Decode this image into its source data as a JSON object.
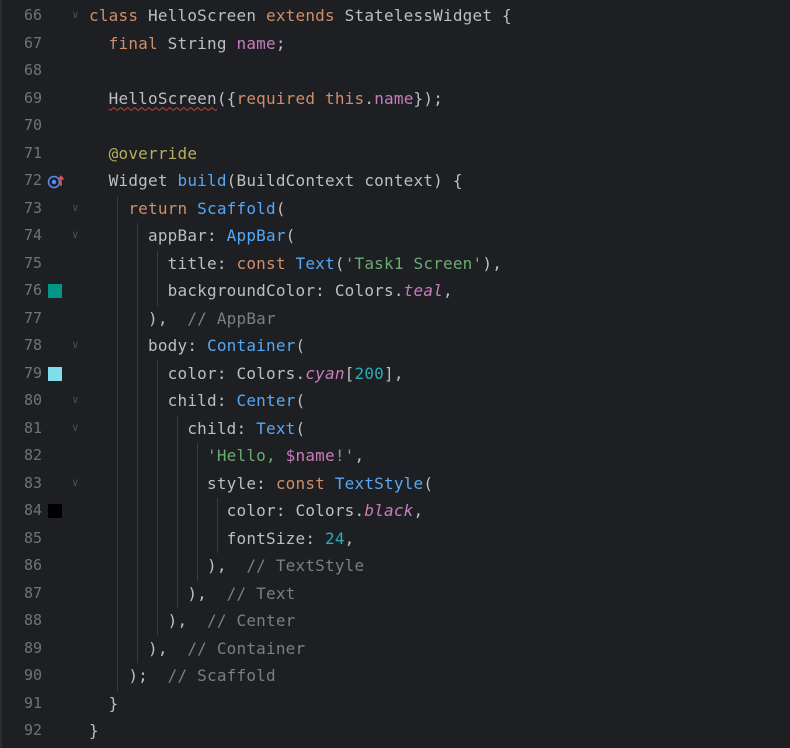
{
  "editor": {
    "colors": {
      "background": "#1e1f22",
      "teal_swatch": "#009688",
      "cyan200_swatch": "#80deea",
      "black_swatch": "#000000"
    },
    "gutter_icon": "override-method-icon",
    "lines": [
      {
        "n": "66",
        "tokens": [
          {
            "t": "class ",
            "c": "kw"
          },
          {
            "t": "HelloScreen ",
            "c": "cls"
          },
          {
            "t": "extends ",
            "c": "kw"
          },
          {
            "t": "StatelessWidget {",
            "c": "cls"
          }
        ]
      },
      {
        "n": "67",
        "tokens": [
          {
            "t": "  final ",
            "c": "kw"
          },
          {
            "t": "String ",
            "c": "cls"
          },
          {
            "t": "name",
            "c": "fld"
          },
          {
            "t": ";",
            "c": "cls"
          }
        ]
      },
      {
        "n": "68",
        "tokens": []
      },
      {
        "n": "69",
        "tokens": [
          {
            "t": "  ",
            "c": "cls"
          },
          {
            "t": "HelloScreen",
            "c": "cls squig"
          },
          {
            "t": "({",
            "c": "cls"
          },
          {
            "t": "required ",
            "c": "kw"
          },
          {
            "t": "this",
            "c": "kw"
          },
          {
            "t": ".",
            "c": "cls"
          },
          {
            "t": "name",
            "c": "fld"
          },
          {
            "t": "});",
            "c": "cls"
          }
        ]
      },
      {
        "n": "70",
        "tokens": []
      },
      {
        "n": "71",
        "tokens": [
          {
            "t": "  @override",
            "c": "ann"
          }
        ]
      },
      {
        "n": "72",
        "tokens": [
          {
            "t": "  Widget ",
            "c": "cls"
          },
          {
            "t": "build",
            "c": "fn"
          },
          {
            "t": "(BuildContext context) {",
            "c": "cls"
          }
        ]
      },
      {
        "n": "73",
        "tokens": [
          {
            "t": "    return ",
            "c": "kw"
          },
          {
            "t": "Scaffold",
            "c": "fn"
          },
          {
            "t": "(",
            "c": "cls"
          }
        ]
      },
      {
        "n": "74",
        "tokens": [
          {
            "t": "      appBar: ",
            "c": "cls"
          },
          {
            "t": "AppBar",
            "c": "fn"
          },
          {
            "t": "(",
            "c": "cls"
          }
        ]
      },
      {
        "n": "75",
        "tokens": [
          {
            "t": "        title: ",
            "c": "cls"
          },
          {
            "t": "const ",
            "c": "kw"
          },
          {
            "t": "Text",
            "c": "fn"
          },
          {
            "t": "(",
            "c": "cls"
          },
          {
            "t": "'Task1 Screen'",
            "c": "str"
          },
          {
            "t": "),",
            "c": "cls"
          }
        ]
      },
      {
        "n": "76",
        "tokens": [
          {
            "t": "        backgroundColor: Colors.",
            "c": "cls"
          },
          {
            "t": "teal",
            "c": "fld ital"
          },
          {
            "t": ",",
            "c": "cls"
          }
        ]
      },
      {
        "n": "77",
        "tokens": [
          {
            "t": "      ),  ",
            "c": "cls"
          },
          {
            "t": "// AppBar",
            "c": "cmt"
          }
        ]
      },
      {
        "n": "78",
        "tokens": [
          {
            "t": "      body: ",
            "c": "cls"
          },
          {
            "t": "Container",
            "c": "fn"
          },
          {
            "t": "(",
            "c": "cls"
          }
        ]
      },
      {
        "n": "79",
        "tokens": [
          {
            "t": "        color: Colors.",
            "c": "cls"
          },
          {
            "t": "cyan",
            "c": "fld ital"
          },
          {
            "t": "[",
            "c": "cls"
          },
          {
            "t": "200",
            "c": "num"
          },
          {
            "t": "],",
            "c": "cls"
          }
        ]
      },
      {
        "n": "80",
        "tokens": [
          {
            "t": "        child: ",
            "c": "cls"
          },
          {
            "t": "Center",
            "c": "fn"
          },
          {
            "t": "(",
            "c": "cls"
          }
        ]
      },
      {
        "n": "81",
        "tokens": [
          {
            "t": "          child: ",
            "c": "cls"
          },
          {
            "t": "Text",
            "c": "fn"
          },
          {
            "t": "(",
            "c": "cls"
          }
        ]
      },
      {
        "n": "82",
        "tokens": [
          {
            "t": "            ",
            "c": "cls"
          },
          {
            "t": "'Hello, ",
            "c": "str"
          },
          {
            "t": "$name",
            "c": "fld"
          },
          {
            "t": "!'",
            "c": "str"
          },
          {
            "t": ",",
            "c": "cls"
          }
        ]
      },
      {
        "n": "83",
        "tokens": [
          {
            "t": "            style: ",
            "c": "cls"
          },
          {
            "t": "const ",
            "c": "kw"
          },
          {
            "t": "TextStyle",
            "c": "fn"
          },
          {
            "t": "(",
            "c": "cls"
          }
        ]
      },
      {
        "n": "84",
        "tokens": [
          {
            "t": "              color: Colors.",
            "c": "cls"
          },
          {
            "t": "black",
            "c": "fld ital"
          },
          {
            "t": ",",
            "c": "cls"
          }
        ]
      },
      {
        "n": "85",
        "tokens": [
          {
            "t": "              fontSize: ",
            "c": "cls"
          },
          {
            "t": "24",
            "c": "num"
          },
          {
            "t": ",",
            "c": "cls"
          }
        ]
      },
      {
        "n": "86",
        "tokens": [
          {
            "t": "            ),  ",
            "c": "cls"
          },
          {
            "t": "// TextStyle",
            "c": "cmt"
          }
        ]
      },
      {
        "n": "87",
        "tokens": [
          {
            "t": "          ),  ",
            "c": "cls"
          },
          {
            "t": "// Text",
            "c": "cmt"
          }
        ]
      },
      {
        "n": "88",
        "tokens": [
          {
            "t": "        ),  ",
            "c": "cls"
          },
          {
            "t": "// Center",
            "c": "cmt"
          }
        ]
      },
      {
        "n": "89",
        "tokens": [
          {
            "t": "      ),  ",
            "c": "cls"
          },
          {
            "t": "// Container",
            "c": "cmt"
          }
        ]
      },
      {
        "n": "90",
        "tokens": [
          {
            "t": "    );  ",
            "c": "cls"
          },
          {
            "t": "// Scaffold",
            "c": "cmt"
          }
        ]
      },
      {
        "n": "91",
        "tokens": [
          {
            "t": "  }",
            "c": "cls"
          }
        ]
      },
      {
        "n": "92",
        "tokens": [
          {
            "t": "}",
            "c": "cls"
          }
        ]
      }
    ]
  }
}
